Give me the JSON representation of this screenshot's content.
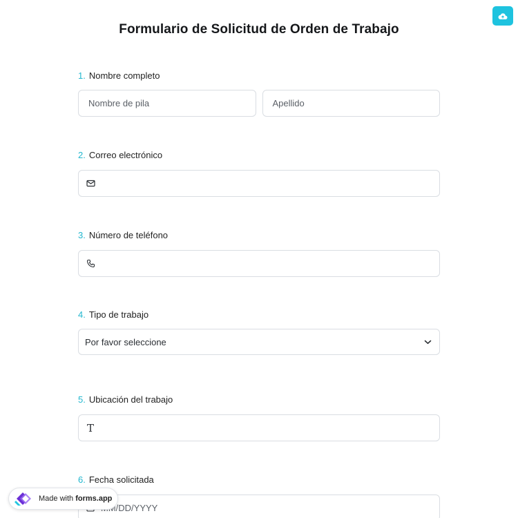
{
  "header": {
    "title": "Formulario de Solicitud de Orden de Trabajo"
  },
  "upload_button": {
    "icon": "cloud-upload-icon"
  },
  "questions": {
    "q1": {
      "number": "1.",
      "label": "Nombre completo",
      "first_placeholder": "Nombre de pila",
      "last_placeholder": "Apellido"
    },
    "q2": {
      "number": "2.",
      "label": "Correo electrónico",
      "icon": "mail-icon"
    },
    "q3": {
      "number": "3.",
      "label": "Número de teléfono",
      "icon": "phone-icon"
    },
    "q4": {
      "number": "4.",
      "label": "Tipo de trabajo",
      "selected": "Por favor seleccione",
      "icon": "chevron-down-icon"
    },
    "q5": {
      "number": "5.",
      "label": "Ubicación del trabajo",
      "icon": "text-icon"
    },
    "q6": {
      "number": "6.",
      "label": "Fecha solicitada",
      "placeholder": "MM/DD/YYYY",
      "icon": "calendar-icon"
    }
  },
  "badge": {
    "prefix": "Made with ",
    "brand": "forms.app"
  },
  "colors": {
    "accent": "#22b7cf",
    "button": "#1ec3df",
    "border": "#d9dde2"
  }
}
